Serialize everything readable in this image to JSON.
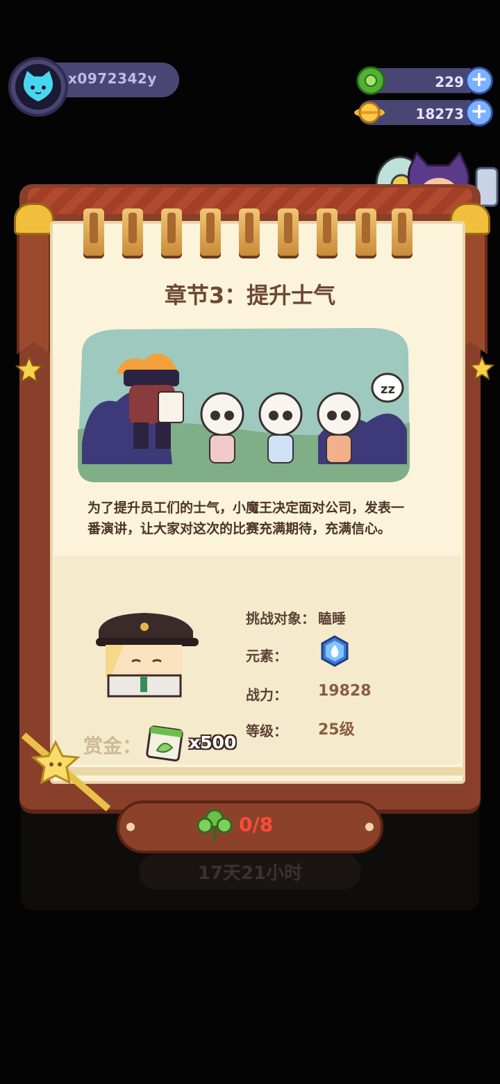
{
  "player": {
    "name": "x0972342y"
  },
  "currencies": [
    {
      "icon": "green-gem-icon",
      "value": "229"
    },
    {
      "icon": "gold-coin-icon",
      "value": "18273"
    }
  ],
  "chapter": {
    "title": "章节3：提升士气",
    "story": "为了提升员工们的士气，小魔王决定面对公司，发表一番演讲，让大家对这次的比赛充满期待，充满信心。"
  },
  "challenge": {
    "target_label": "挑战对象：",
    "target_value": "瞌睡",
    "element_label": "元素：",
    "element_icon": "water-element-icon",
    "power_label": "战力：",
    "power_value": "19828",
    "level_label": "等级：",
    "level_value": "25级"
  },
  "reward": {
    "label": "赏金：",
    "count": "x500"
  },
  "progress": {
    "text": "0/8"
  },
  "timer": {
    "text": "17天21小时"
  },
  "colors": {
    "page": "#fbf3da",
    "board": "#8a3f2a",
    "title": "#6d4634",
    "progress_red": "#ff4a3a",
    "hud_bar": "#4a4674"
  }
}
